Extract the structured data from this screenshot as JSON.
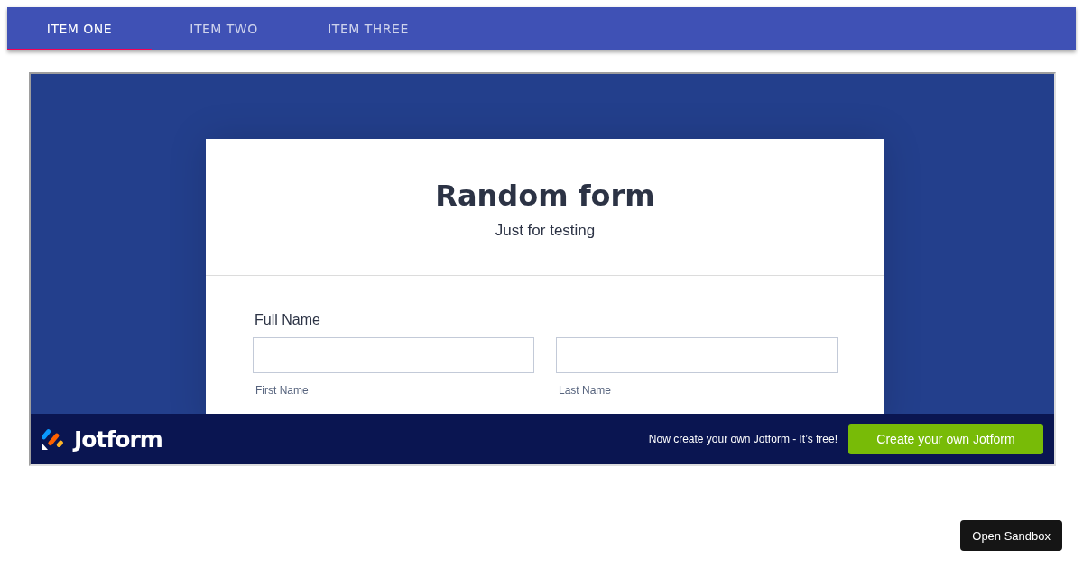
{
  "tabs": [
    {
      "label": "ITEM ONE",
      "selected": true
    },
    {
      "label": "ITEM TWO",
      "selected": false
    },
    {
      "label": "ITEM THREE",
      "selected": false
    }
  ],
  "form": {
    "title": "Random form",
    "subtitle": "Just for testing",
    "field_label": "Full Name",
    "inputs": [
      {
        "sublabel": "First Name"
      },
      {
        "sublabel": "Last Name"
      }
    ]
  },
  "footer": {
    "brand": "Jotform",
    "promo": "Now create your own Jotform - It’s free!",
    "button": "Create your own Jotform"
  },
  "sandbox_button": "Open Sandbox"
}
